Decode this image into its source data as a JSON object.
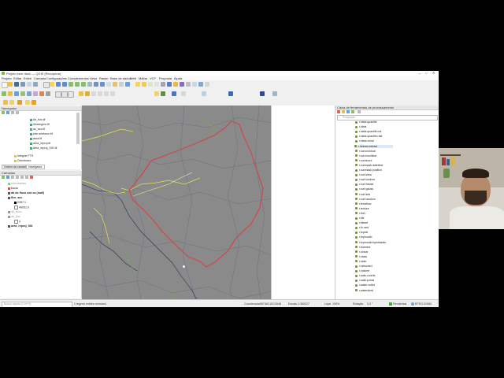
{
  "window": {
    "title": "Projeto sem título — QGIS [Recuperar]",
    "controls": [
      "—",
      "□",
      "✕"
    ]
  },
  "menu": [
    "Projeto",
    "Editar",
    "Exibir",
    "Camada",
    "Configurações",
    "Complementos",
    "Vetor",
    "Raster",
    "Base de dados",
    "Web",
    "Malha",
    "VCF",
    "Proposta",
    "Ajuda"
  ],
  "browser": {
    "title": "Navegador",
    "items": [
      "dir_flux.tif",
      "dinaregion.tif",
      "ac_acc.tif",
      "stre.reinforce.tif",
      "area.tif",
      "area_reproj.tif",
      "area_reproj_SIG.tif",
      "Integrar FTS",
      "Odontosec"
    ],
    "tabs": [
      "Ordem da camada",
      "Navegador"
    ]
  },
  "layers": {
    "title": "Camadas",
    "items": [
      "microbacias",
      "bacia",
      "ab do fluxo sob ca (mall)",
      "flux_acc",
      "0357.1",
      "40051.0",
      "dir_fluxo",
      "ab_flux",
      "0",
      "area_reproj_SIK"
    ]
  },
  "toolbox": {
    "title": "Caixa de ferramentas de processamento",
    "search_placeholder": "Pesquisar...",
    "items": [
      "r.stats.quantile",
      "r.stats",
      "r.stats.quantile.out",
      "r.stats.quantile.rast",
      "r.stats.zonal",
      "r.stream.extract",
      "r.sun.incidout",
      "r.sun.insoltime",
      "r.sunhours",
      "r.sunmask.datetime",
      "r.sunmask.position",
      "r.surf.area",
      "r.surf.contour",
      "r.surf.fractal",
      "r.surf.gauss",
      "r.surf.idw",
      "r.surf.random",
      "r.terraflow",
      "r.texture",
      "r.thin",
      "r.tile",
      "r.tileset",
      "r.to.vect",
      "r.topidx",
      "r.topmodel",
      "r.topmodel.topidxstats",
      "r.transect",
      "r.univar",
      "r.uslek",
      "r.usler",
      "r.viewshed",
      "r.volume",
      "r.walk.coords",
      "r.walk.points",
      "r.water.outlet",
      "r.watershed"
    ],
    "highlight": "r.stream.extract"
  },
  "status": {
    "search_placeholder": "Busca rápida (Ctrl+K)",
    "message": "1 legend entries removed.",
    "coord_label": "Coordenada",
    "coord": "557462,8213048",
    "scale_label": "Escala",
    "scale": "1:369227",
    "magnifier_label": "Lupa",
    "magnifier": "100%",
    "rotation_label": "Rotação",
    "rotation": "0,0 °",
    "render_label": "Renderizar",
    "crs": "EPSG:31983"
  },
  "colors": {
    "map_bg": "#8a8a8a",
    "basin_outline": "#d0474a",
    "stream_yellow": "#e6e24a",
    "stream_green": "#6fae4a",
    "stream_dark": "#243c73"
  }
}
